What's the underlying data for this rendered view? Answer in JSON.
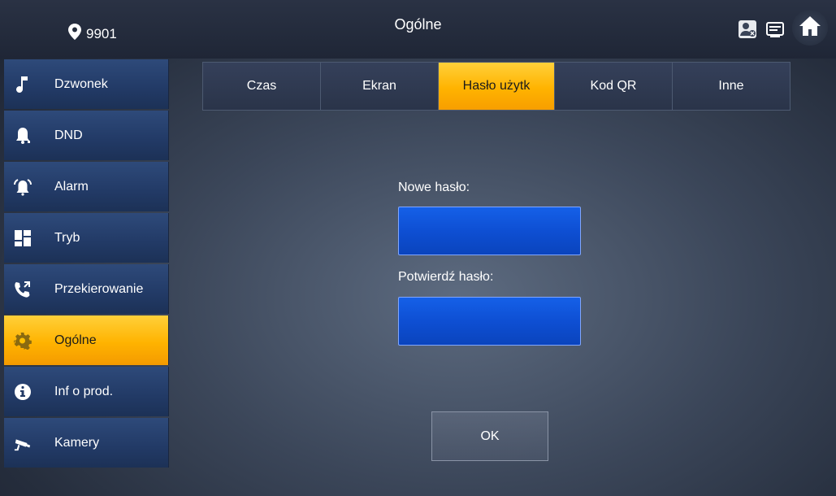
{
  "header": {
    "title": "Ogólne",
    "location_number": "9901",
    "icons": [
      "location-pin-icon",
      "contact-status-icon",
      "message-icon",
      "home-icon"
    ]
  },
  "sidebar": {
    "items": [
      {
        "label": "Dzwonek",
        "icon": "music-note-icon"
      },
      {
        "label": "DND",
        "icon": "bell-mute-icon"
      },
      {
        "label": "Alarm",
        "icon": "alarm-icon"
      },
      {
        "label": "Tryb",
        "icon": "grid-mode-icon"
      },
      {
        "label": "Przekierowanie",
        "icon": "call-forward-icon"
      },
      {
        "label": "Ogólne",
        "icon": "gear-icon",
        "active": true
      },
      {
        "label": "Inf o prod.",
        "icon": "info-icon"
      },
      {
        "label": "Kamery",
        "icon": "camera-icon"
      }
    ]
  },
  "tabs": [
    {
      "label": "Czas"
    },
    {
      "label": "Ekran"
    },
    {
      "label": "Hasło użytk",
      "active": true
    },
    {
      "label": "Kod QR"
    },
    {
      "label": "Inne"
    }
  ],
  "form": {
    "new_password_label": "Nowe hasło:",
    "new_password_value": "",
    "confirm_password_label": "Potwierdź hasło:",
    "confirm_password_value": "",
    "ok_label": "OK"
  },
  "colors": {
    "accent": "#ffb300",
    "sidebar_bg": "#223a66",
    "field_bg": "#0e4fd3"
  }
}
